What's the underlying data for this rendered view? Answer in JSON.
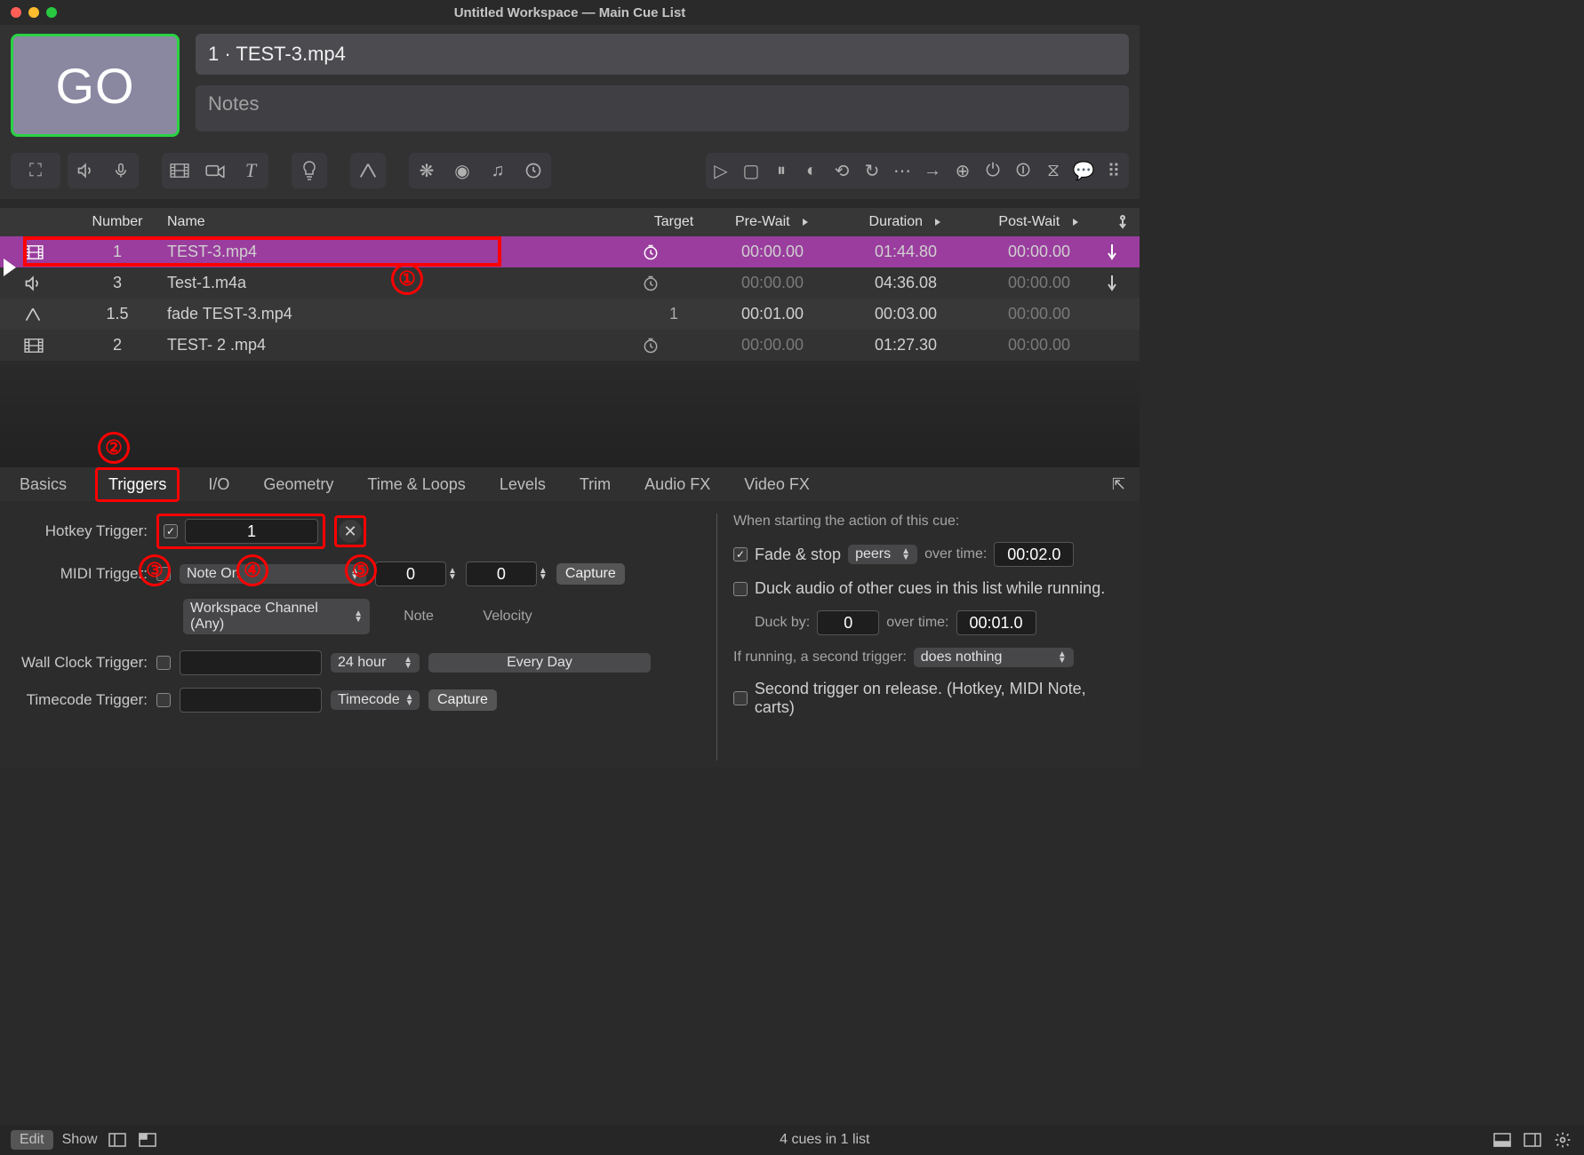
{
  "title": "Untitled Workspace — Main Cue List",
  "go_label": "GO",
  "current_cue": "1 · TEST-3.mp4",
  "notes_placeholder": "Notes",
  "columns": {
    "number": "Number",
    "name": "Name",
    "target": "Target",
    "prewait": "Pre-Wait",
    "duration": "Duration",
    "postwait": "Post-Wait"
  },
  "cues": [
    {
      "icon": "video",
      "number": "1",
      "name": "TEST-3.mp4",
      "target_icon": true,
      "target_text": "",
      "prewait": "00:00.00",
      "duration": "01:44.80",
      "postwait": "00:00.00",
      "continue": true,
      "selected": true,
      "dim_prewait": false,
      "dim_postwait": false
    },
    {
      "icon": "audio",
      "number": "3",
      "name": "Test-1.m4a",
      "target_icon": true,
      "target_text": "",
      "prewait": "00:00.00",
      "duration": "04:36.08",
      "postwait": "00:00.00",
      "continue": true,
      "selected": false,
      "dim_prewait": true,
      "dim_postwait": true
    },
    {
      "icon": "fade",
      "number": "1.5",
      "name": "fade TEST-3.mp4",
      "target_icon": false,
      "target_text": "1",
      "prewait": "00:01.00",
      "duration": "00:03.00",
      "postwait": "00:00.00",
      "continue": false,
      "selected": false,
      "dim_prewait": false,
      "dim_postwait": true
    },
    {
      "icon": "video",
      "number": "2",
      "name": "TEST- 2 .mp4",
      "target_icon": true,
      "target_text": "",
      "prewait": "00:00.00",
      "duration": "01:27.30",
      "postwait": "00:00.00",
      "continue": false,
      "selected": false,
      "dim_prewait": true,
      "dim_postwait": true
    }
  ],
  "tabs": [
    "Basics",
    "Triggers",
    "I/O",
    "Geometry",
    "Time & Loops",
    "Levels",
    "Trim",
    "Audio FX",
    "Video FX"
  ],
  "active_tab": "Triggers",
  "triggers": {
    "hotkey_label": "Hotkey Trigger:",
    "hotkey_checked": true,
    "hotkey_value": "1",
    "midi_label": "MIDI Trigger:",
    "midi_checked": false,
    "midi_type": "Note On",
    "midi_channel": "Workspace Channel (Any)",
    "midi_note_value": "0",
    "midi_vel_value": "0",
    "midi_note_label": "Note",
    "midi_vel_label": "Velocity",
    "capture": "Capture",
    "wallclock_label": "Wall Clock Trigger:",
    "wallclock_checked": false,
    "wallclock_format": "24 hour",
    "wallclock_days": "Every Day",
    "timecode_label": "Timecode Trigger:",
    "timecode_checked": false,
    "timecode_type": "Timecode"
  },
  "right_panel": {
    "heading": "When starting the action of this cue:",
    "fade_stop_checked": true,
    "fade_stop_label": "Fade & stop",
    "fade_stop_target": "peers",
    "over_time_label": "over time:",
    "fade_stop_time": "00:02.0",
    "duck_label": "Duck audio of other cues in this list while running.",
    "duck_checked": false,
    "duck_by_label": "Duck by:",
    "duck_by_value": "0",
    "duck_time": "00:01.0",
    "second_trigger_label": "If running, a second trigger:",
    "second_trigger_value": "does nothing",
    "release_label": "Second trigger on release. (Hotkey, MIDI Note, carts)",
    "release_checked": false
  },
  "statusbar": {
    "edit": "Edit",
    "show": "Show",
    "summary": "4 cues in 1 list"
  },
  "annotations": [
    "①",
    "②",
    "③",
    "④",
    "⑤"
  ]
}
